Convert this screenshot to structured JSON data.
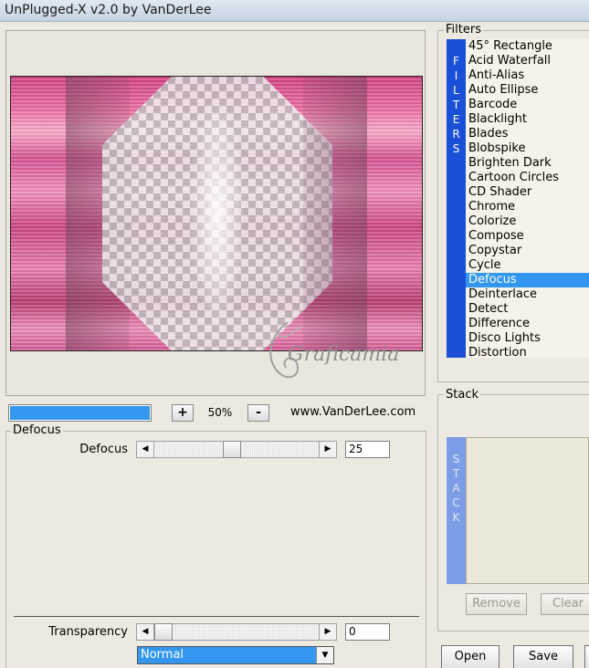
{
  "window": {
    "title": "UnPlugged-X v2.0 by VanDerLee"
  },
  "preview": {
    "zoom": "50%",
    "zoom_in": "+",
    "zoom_out": "-",
    "progress_fraction": 1.0,
    "website": "www.VanDerLee.com",
    "watermark_text": "Graficamia"
  },
  "filter_panel": {
    "group_title": "Defocus",
    "defocus": {
      "label": "Defocus",
      "value": "25",
      "fraction": 0.47
    },
    "transparency": {
      "label": "Transparency",
      "value": "0",
      "fraction": 0.0
    },
    "blend_mode": "Normal",
    "left_arrow": "◀",
    "right_arrow": "▶",
    "dropdown_arrow": "▼"
  },
  "filters": {
    "title": "Filters",
    "sidebar_letters": [
      "F",
      "I",
      "L",
      "T",
      "E",
      "R",
      "S"
    ],
    "items": [
      "45° Rectangle",
      "Acid Waterfall",
      "Anti-Alias",
      "Auto Ellipse",
      "Barcode",
      "Blacklight",
      "Blades",
      "Blobspike",
      "Brighten Dark",
      "Cartoon Circles",
      "CD Shader",
      "Chrome",
      "Colorize",
      "Compose",
      "Copystar",
      "Cycle",
      "Defocus",
      "Deinterlace",
      "Detect",
      "Difference",
      "Disco Lights",
      "Distortion"
    ],
    "selected": "Defocus"
  },
  "stack": {
    "title": "Stack",
    "sidebar_letters": [
      "S",
      "T",
      "A",
      "C",
      "K"
    ],
    "remove_label": "Remove",
    "clear_label": "Clear"
  },
  "actions": {
    "open_label": "Open",
    "save_label": "Save"
  }
}
